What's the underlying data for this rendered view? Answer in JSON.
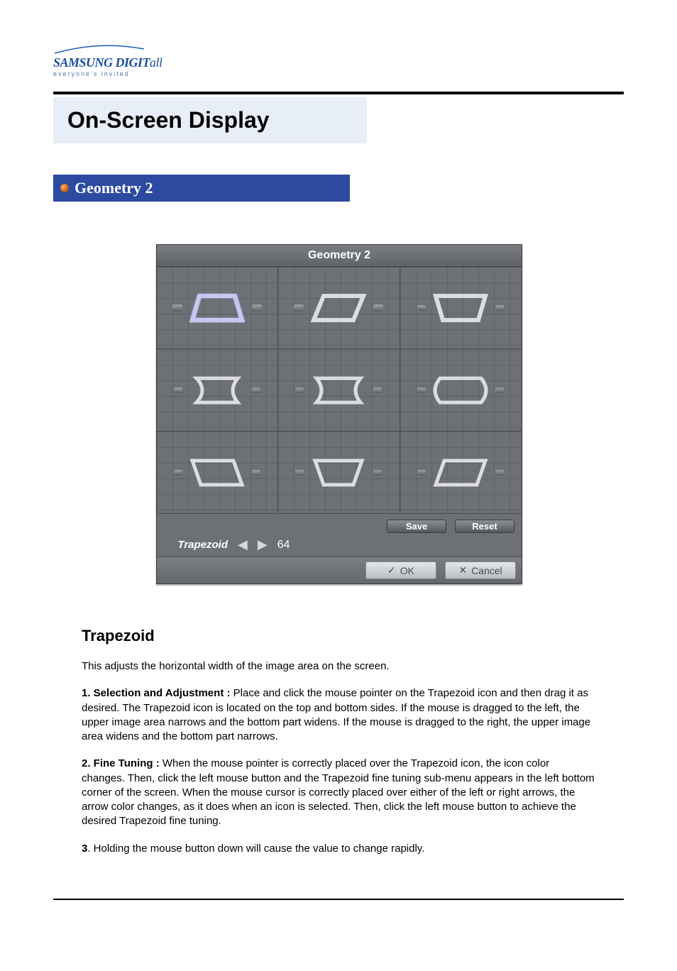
{
  "logo": {
    "line1_main": "SAMSUNG DIGIT",
    "line1_tail": "all",
    "line2": "everyone's invited"
  },
  "page_title": "On-Screen Display",
  "section_title": "Geometry 2",
  "osd": {
    "title": "Geometry 2",
    "icons": [
      {
        "name": "trapezoid",
        "selected": true
      },
      {
        "name": "parallelogram",
        "selected": false
      },
      {
        "name": "trapezoid-reverse",
        "selected": false
      },
      {
        "name": "pin-balance-left",
        "selected": false
      },
      {
        "name": "pincushion",
        "selected": false
      },
      {
        "name": "pin-balance-right",
        "selected": false
      },
      {
        "name": "trapezoid-bottom-left",
        "selected": false
      },
      {
        "name": "trapezoid-bottom",
        "selected": false
      },
      {
        "name": "trapezoid-bottom-right",
        "selected": false
      }
    ],
    "adjust_label": "Trapezoid",
    "adjust_value": "64",
    "save": "Save",
    "reset": "Reset",
    "ok": "OK",
    "cancel": "Cancel"
  },
  "content": {
    "heading": "Trapezoid",
    "intro": "This adjusts the horizontal width of the image area on the screen.",
    "p1_lead": "1. Selection and Adjustment :",
    "p1_body": " Place and click the mouse pointer on the Trapezoid icon and then drag it as desired. The Trapezoid icon is located on the top and bottom sides. If the mouse is dragged to the left, the upper image area narrows and the bottom part widens. If the mouse is dragged to the right, the upper image area widens and the bottom part narrows.",
    "p2_lead": "2. Fine Tuning :",
    "p2_body": " When the mouse pointer is correctly placed over the Trapezoid icon, the icon color changes. Then, click the left mouse button and the Trapezoid fine tuning sub-menu appears in the left bottom corner of the screen. When the mouse cursor is correctly placed over either of the left or right arrows, the arrow color changes, as it does when an icon is selected. Then, click the left mouse button to achieve the desired Trapezoid fine tuning.",
    "p3_lead": "3",
    "p3_body": ". Holding the mouse button down will cause the value to change rapidly."
  }
}
